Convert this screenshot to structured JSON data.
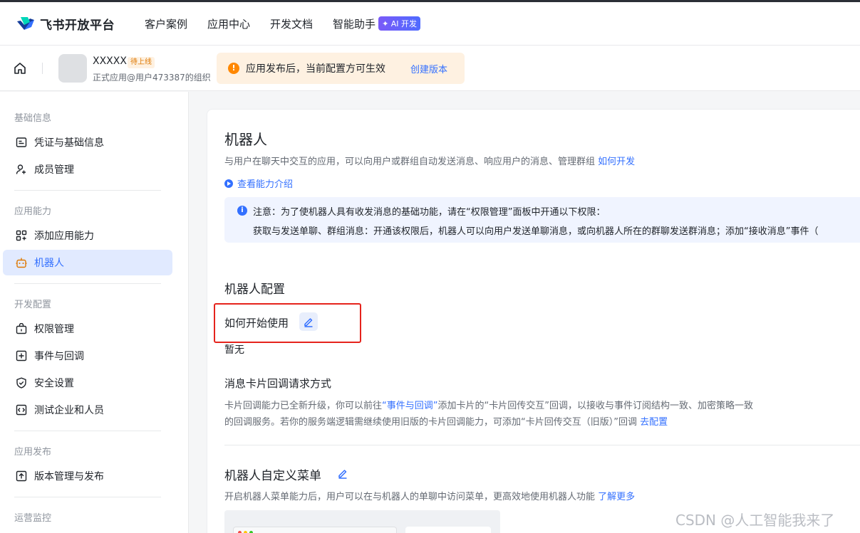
{
  "topbar": {
    "brand": "飞书开放平台",
    "nav": [
      "客户案例",
      "应用中心",
      "开发文档",
      "智能助手"
    ],
    "ai_badge": "✦ AI 开发"
  },
  "appbar": {
    "app_name": "XXXXX",
    "app_status": "待上线",
    "app_sub": "正式应用@用户473387的组织",
    "notice_text": "应用发布后，当前配置方可生效",
    "notice_link": "创建版本"
  },
  "sidebar": {
    "groups": [
      "基础信息",
      "应用能力",
      "开发配置",
      "应用发布",
      "运营监控"
    ],
    "items": [
      {
        "label": "凭证与基础信息",
        "icon": "credential-icon"
      },
      {
        "label": "成员管理",
        "icon": "member-add-icon"
      },
      {
        "label": "添加应用能力",
        "icon": "grid-add-icon"
      },
      {
        "label": "机器人",
        "icon": "robot-icon"
      },
      {
        "label": "权限管理",
        "icon": "lock-box-icon"
      },
      {
        "label": "事件与回调",
        "icon": "event-add-icon"
      },
      {
        "label": "安全设置",
        "icon": "shield-check-icon"
      },
      {
        "label": "测试企业和人员",
        "icon": "test-code-icon"
      },
      {
        "label": "版本管理与发布",
        "icon": "upload-box-icon"
      }
    ]
  },
  "main": {
    "title": "机器人",
    "desc": "与用户在聊天中交互的应用，可以向用户或群组自动发送消息、响应用户的消息、管理群组",
    "desc_link": "如何开发",
    "intro_link": "查看能力介绍",
    "tip_line1": "注意：为了使机器人具有收发消息的基础功能，请在“权限管理”面板中开通以下权限：",
    "tip_line2": "获取与发送单聊、群组消息：开通该权限后，机器人可以向用户发送单聊消息，或向机器人所在的群聊发送群消息；添加“接收消息”事件（",
    "config_title": "机器人配置",
    "how_to_start": "如何开始使用",
    "none_text": "暂无",
    "card_cb_title": "消息卡片回调请求方式",
    "card_cb_p1_a": "卡片回调能力已全新升级，你可以前往",
    "card_cb_p1_link": "“事件与回调”",
    "card_cb_p1_b": "添加卡片的“卡片回传交互”回调，以接收与事件订阅结构一致、加密策略一致",
    "card_cb_p2": "的回调服务。若你的服务端逻辑需继续使用旧版的卡片回调能力，可添加“卡片回传交互（旧版）”回调",
    "card_cb_p2_link": "去配置",
    "menu_title": "机器人自定义菜单",
    "menu_desc": "开启机器人菜单能力后，用户可以在与机器人的单聊中访问菜单，更高效地使用机器人功能",
    "menu_link": "了解更多"
  },
  "watermark": "CSDN @人工智能我来了",
  "colors": {
    "accent": "#3370ff",
    "active_bg": "#e1eaff",
    "warning": "#ff8800",
    "highlight_box": "#e5231c"
  }
}
